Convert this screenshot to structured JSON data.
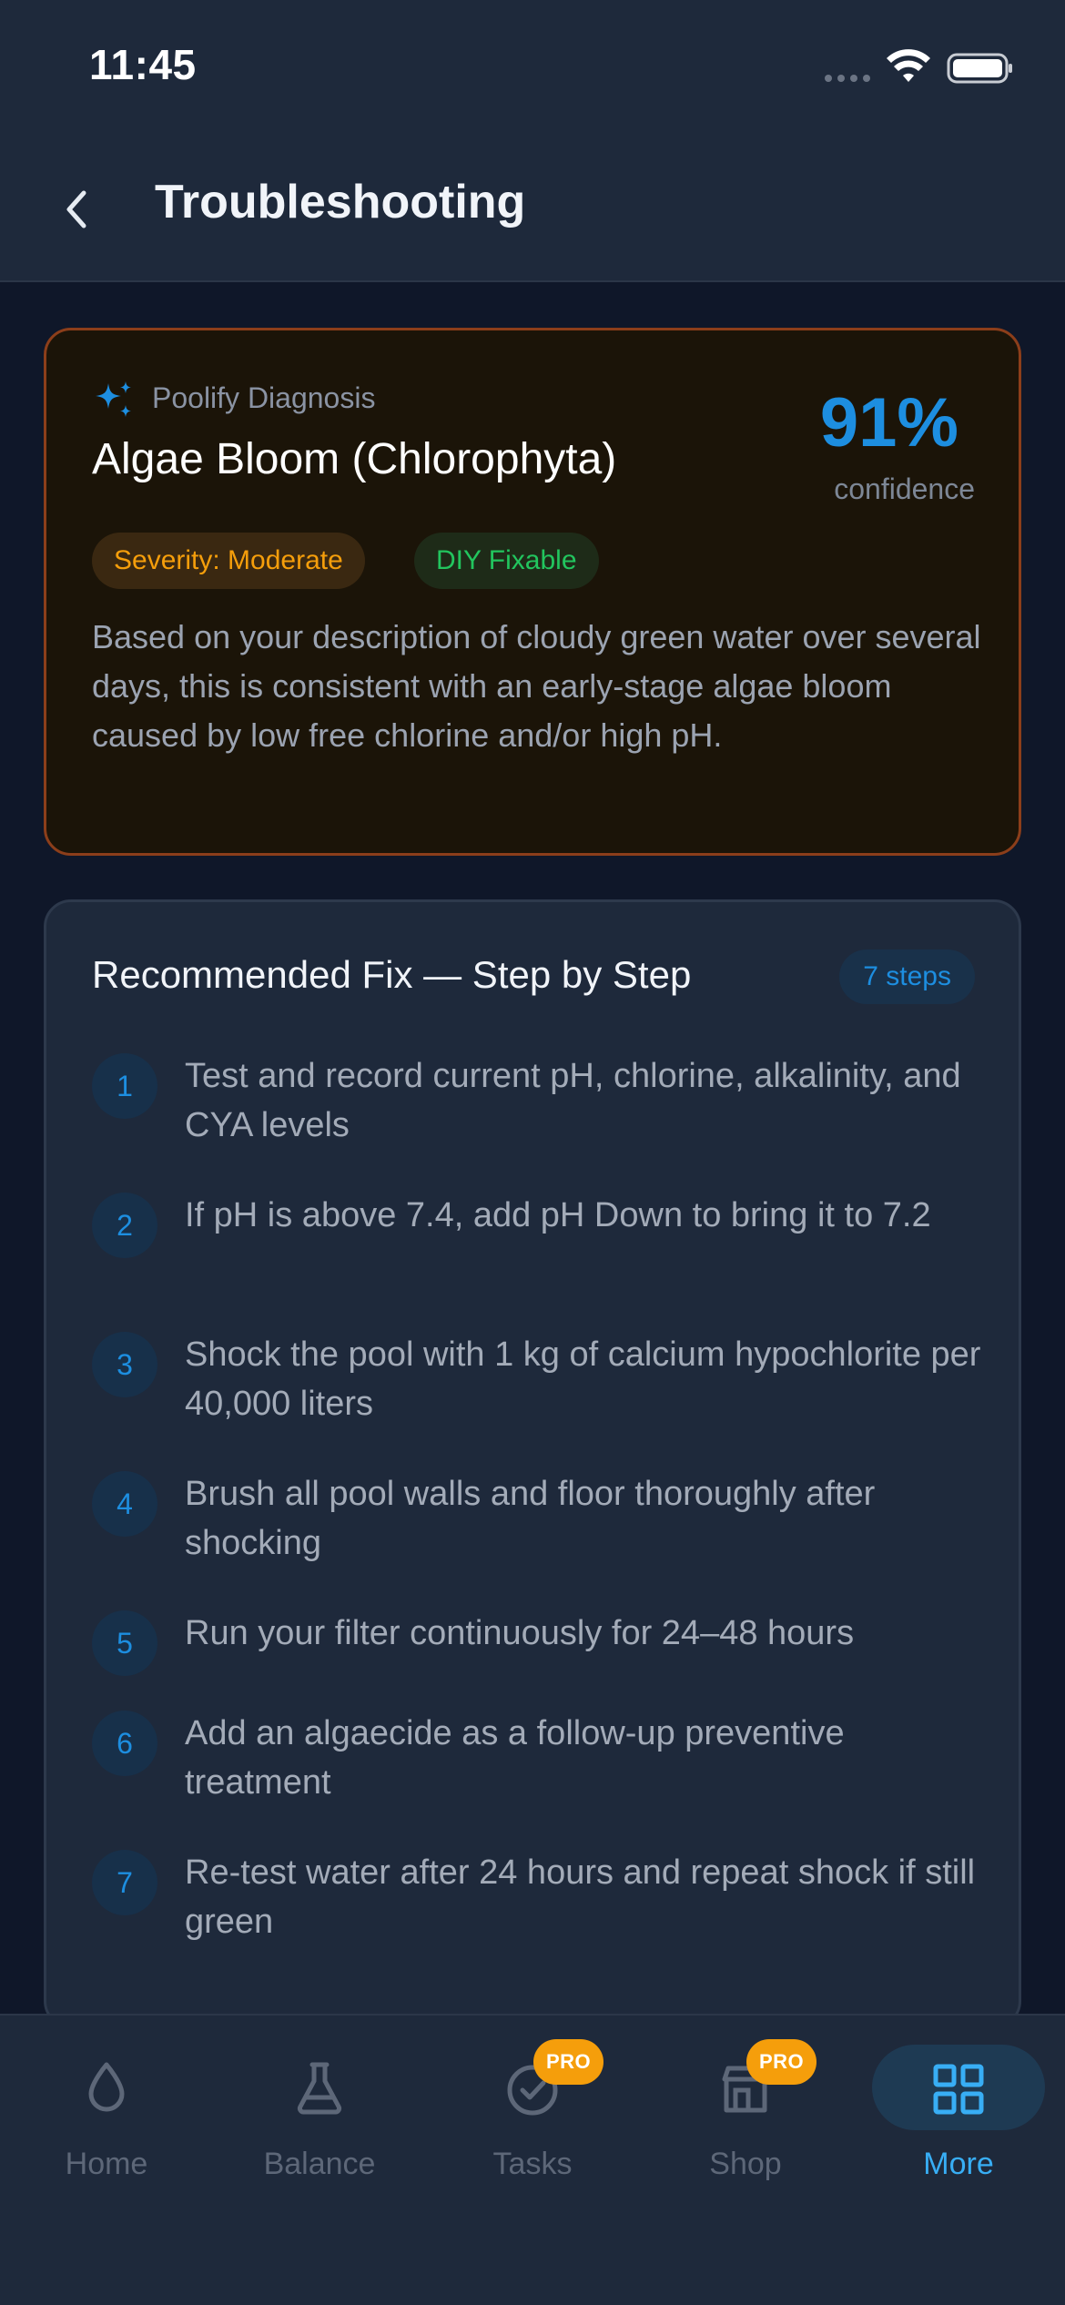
{
  "status_bar": {
    "time": "11:45"
  },
  "header": {
    "title": "Troubleshooting"
  },
  "diagnosis": {
    "label": "Poolify Diagnosis",
    "title": "Algae Bloom (Chlorophyta)",
    "confidence_value": "91%",
    "confidence_label": "confidence",
    "severity_badge": "Severity: Moderate",
    "diy_badge": "DIY Fixable",
    "description": "Based on your description of cloudy green water over several days, this is consistent with an early-stage algae bloom caused by low free chlorine and/or high pH.",
    "colors": {
      "accent": "#1d8ee0",
      "severity": "#f59e0b",
      "diy": "#22c55e",
      "border": "#8c3e1a"
    }
  },
  "steps_section": {
    "title": "Recommended Fix — Step by Step",
    "count_label": "7 steps",
    "steps": [
      {
        "num": "1",
        "text": "Test and record current pH, chlorine, alkalinity, and CYA levels"
      },
      {
        "num": "2",
        "text": "If pH is above 7.4, add pH Down to bring it to 7.2"
      },
      {
        "num": "3",
        "text": "Shock the pool with 1 kg of calcium hypochlorite per 40,000 liters"
      },
      {
        "num": "4",
        "text": "Brush all pool walls and floor thoroughly after shocking"
      },
      {
        "num": "5",
        "text": "Run your filter continuously for 24–48 hours"
      },
      {
        "num": "6",
        "text": "Add an algaecide as a follow-up preventive treatment"
      },
      {
        "num": "7",
        "text": "Re-test water after 24 hours and repeat shock if still green"
      }
    ]
  },
  "tab_bar": {
    "tabs": [
      {
        "label": "Home",
        "icon": "droplet-icon"
      },
      {
        "label": "Balance",
        "icon": "flask-icon"
      },
      {
        "label": "Tasks",
        "icon": "check-circle-icon",
        "badge": "PRO"
      },
      {
        "label": "Shop",
        "icon": "store-icon",
        "badge": "PRO"
      },
      {
        "label": "More",
        "icon": "grid-icon",
        "active": true
      }
    ]
  }
}
